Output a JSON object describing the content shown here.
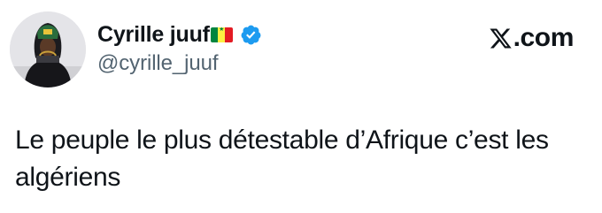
{
  "author": {
    "display_name": "Cyrille juuf",
    "handle": "@cyrille_juuf",
    "flag_icon": "senegal-flag-icon",
    "verified_icon": "verified-badge-icon",
    "verified_color": "#1d9bf0"
  },
  "brand": {
    "logo_icon": "x-logo-icon",
    "domain_text": ".com"
  },
  "tweet": {
    "text": "Le peuple le plus détestable d’Afrique c’est les algériens"
  },
  "colors": {
    "text_primary": "#0f1419",
    "text_secondary": "#536471",
    "background": "#ffffff"
  }
}
